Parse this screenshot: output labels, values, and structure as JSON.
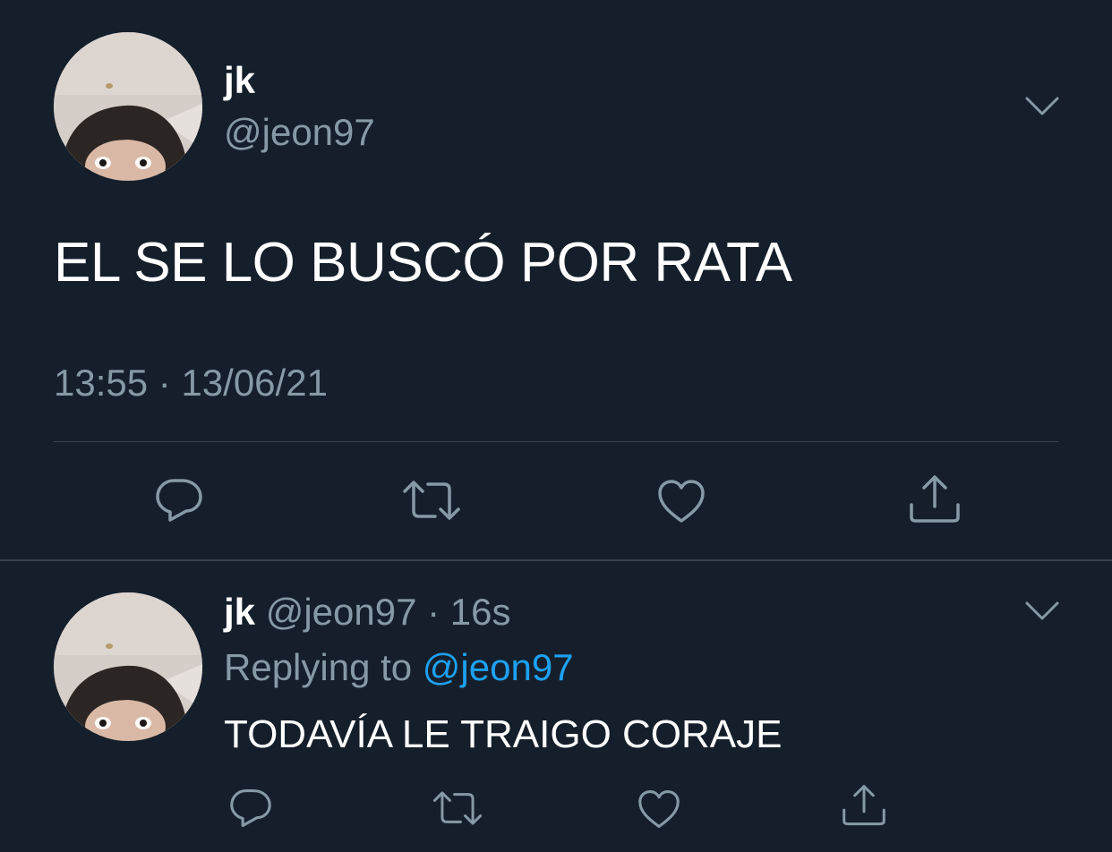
{
  "main_tweet": {
    "display_name": "jk",
    "handle": "@jeon97",
    "text": "EL SE LO BUSCÓ POR RATA",
    "time": "13:55",
    "separator": "·",
    "date": "13/06/21"
  },
  "reply_tweet": {
    "display_name": "jk",
    "handle": "@jeon97",
    "separator": "·",
    "age": "16s",
    "replying_prefix": "Replying to",
    "replying_to": "@jeon97",
    "text": "TODAVÍA LE TRAIGO CORAJE"
  },
  "icons": {
    "reply": "speech-bubble-icon",
    "retweet": "retweet-arrows-icon",
    "like": "heart-icon",
    "share": "share-upload-icon",
    "menu": "chevron-down-icon"
  },
  "colors": {
    "background": "#151f2b",
    "text": "#ffffff",
    "secondary_text": "#8899a6",
    "link": "#1da1f2",
    "divider": "#38444d"
  }
}
